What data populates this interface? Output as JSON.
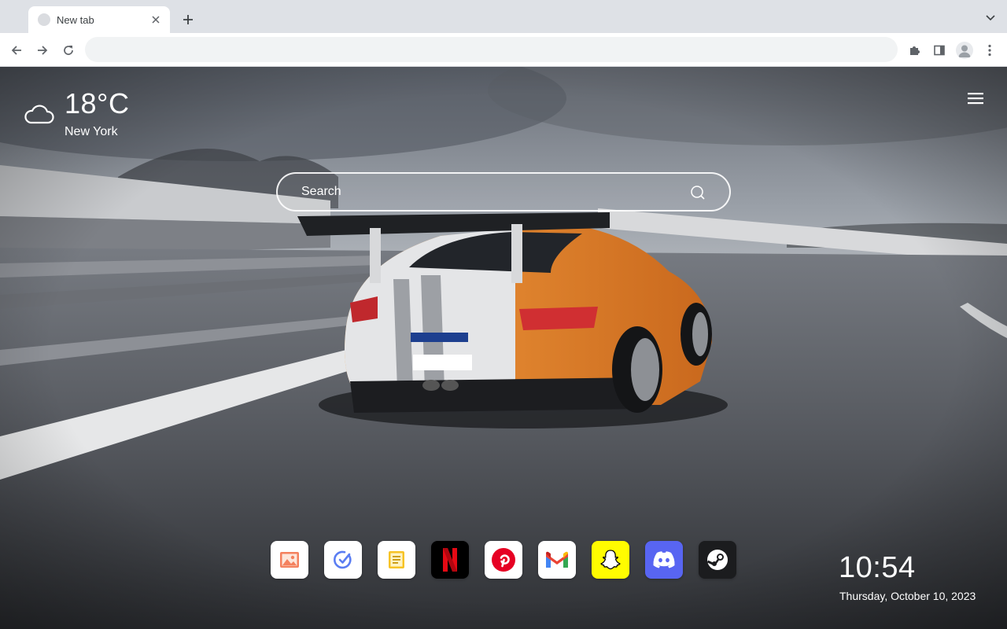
{
  "browser": {
    "tab_title": "New tab",
    "omnibox_value": "",
    "omnibox_placeholder": ""
  },
  "weather": {
    "temperature": "18°C",
    "city": "New York",
    "icon": "cloud-icon"
  },
  "search": {
    "placeholder": "Search"
  },
  "dock": {
    "apps": [
      {
        "name": "photos",
        "icon": "photos-icon"
      },
      {
        "name": "tasks",
        "icon": "check-icon"
      },
      {
        "name": "notes",
        "icon": "notes-icon"
      },
      {
        "name": "netflix",
        "icon": "netflix-icon",
        "color": "#e50914"
      },
      {
        "name": "pinterest",
        "icon": "pinterest-icon",
        "color": "#e60023"
      },
      {
        "name": "gmail",
        "icon": "gmail-icon",
        "color": "#ea4335"
      },
      {
        "name": "snapchat",
        "icon": "snapchat-icon",
        "color": "#fffc00"
      },
      {
        "name": "discord",
        "icon": "discord-icon",
        "color": "#5865f2"
      },
      {
        "name": "steam",
        "icon": "steam-icon",
        "color": "#171a21"
      }
    ]
  },
  "clock": {
    "time": "10:54",
    "date": "Thursday, October 10, 2023"
  },
  "background": {
    "description_colors": {
      "sky": "#8a9099",
      "track": "#5d6066",
      "car_orange": "#e8892d"
    }
  }
}
